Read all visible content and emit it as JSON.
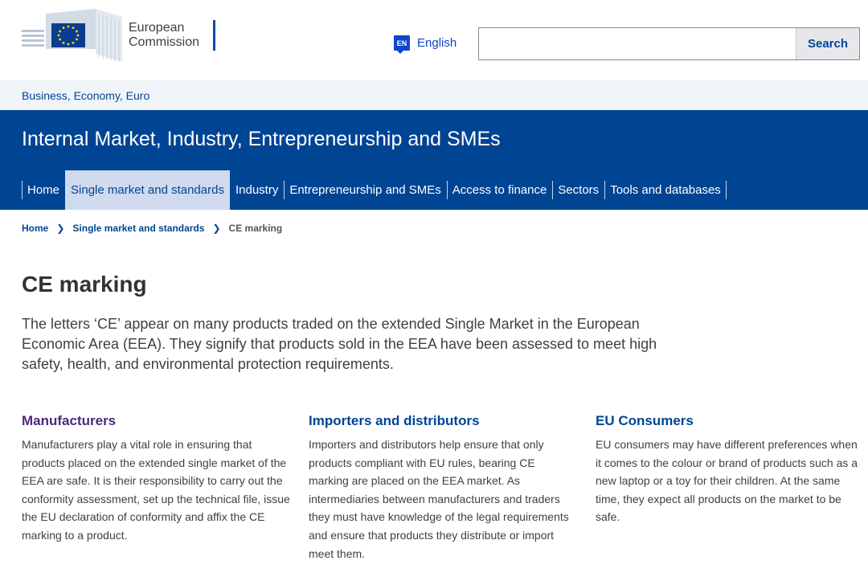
{
  "header": {
    "logo_line1": "European",
    "logo_line2": "Commission",
    "language_code": "EN",
    "language_label": "English",
    "search_placeholder": "",
    "search_button": "Search"
  },
  "sitebar": {
    "link": "Business, Economy, Euro"
  },
  "banner": {
    "title": "Internal Market, Industry, Entrepreneurship and SMEs",
    "nav": [
      {
        "label": "Home"
      },
      {
        "label": "Single market and standards"
      },
      {
        "label": "Industry"
      },
      {
        "label": "Entrepreneurship and SMEs"
      },
      {
        "label": "Access to finance"
      },
      {
        "label": "Sectors"
      },
      {
        "label": "Tools and databases"
      }
    ]
  },
  "breadcrumb": {
    "home": "Home",
    "section": "Single market and standards",
    "current": "CE marking"
  },
  "main": {
    "title": "CE marking",
    "intro": "The letters ‘CE’ appear on many products traded on the extended Single Market in the European Economic Area (EEA). They signify that products sold in the EEA have been assessed to meet high safety, health, and environmental protection requirements.",
    "columns": [
      {
        "heading": "Manufacturers",
        "text": "Manufacturers play a vital role in ensuring that products placed on the extended single market of the EEA are safe. It is their responsibility to carry out the conformity assessment, set up the technical file, issue the EU declaration of conformity and affix the CE marking to a product."
      },
      {
        "heading": "Importers and distributors",
        "text": "Importers and distributors help ensure that only products compliant with EU rules, bearing CE marking are placed on the EEA market. As intermediaries between manufacturers and traders they must have knowledge of the legal requirements and ensure that products they distribute or import meet them."
      },
      {
        "heading": "EU Consumers",
        "text": "EU consumers may have different preferences when it comes to the colour or brand of products such as a new laptop or a toy for their children. At the same time, they expect all products on the market to be safe."
      }
    ]
  },
  "colors": {
    "brand_blue": "#004494",
    "active_nav": "#cfdaee",
    "visited_heading": "#4b2a7b"
  }
}
